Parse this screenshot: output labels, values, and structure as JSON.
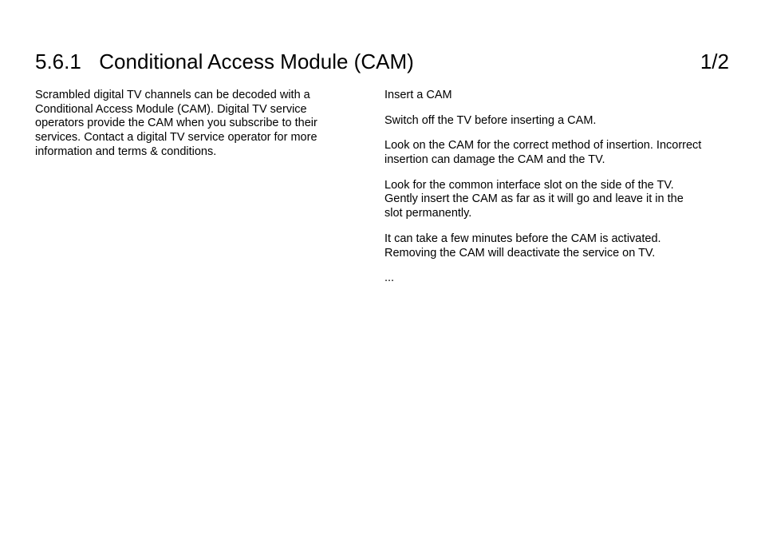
{
  "header": {
    "section_number": "5.6.1",
    "section_title": "Conditional Access Module (CAM)",
    "page_indicator": "1/2"
  },
  "left_column": {
    "p1": "Scrambled digital TV channels can be decoded with a Conditional Access Module (CAM). Digital TV service operators provide the CAM when you subscribe to their services. Contact a digital TV service operator for more information and terms & conditions."
  },
  "right_column": {
    "p1": "Insert a CAM",
    "p2": "Switch off the TV before inserting a CAM.",
    "p3": "Look on the CAM for the correct method of insertion. Incorrect insertion can damage the CAM and the TV.",
    "p4": "Look for the common interface slot on the side of the TV. Gently insert the CAM as far as it will go and leave it in the slot permanently.",
    "p5": "It can take a few minutes before the CAM is activated. Removing the CAM will deactivate the service on TV.",
    "p6": "..."
  }
}
